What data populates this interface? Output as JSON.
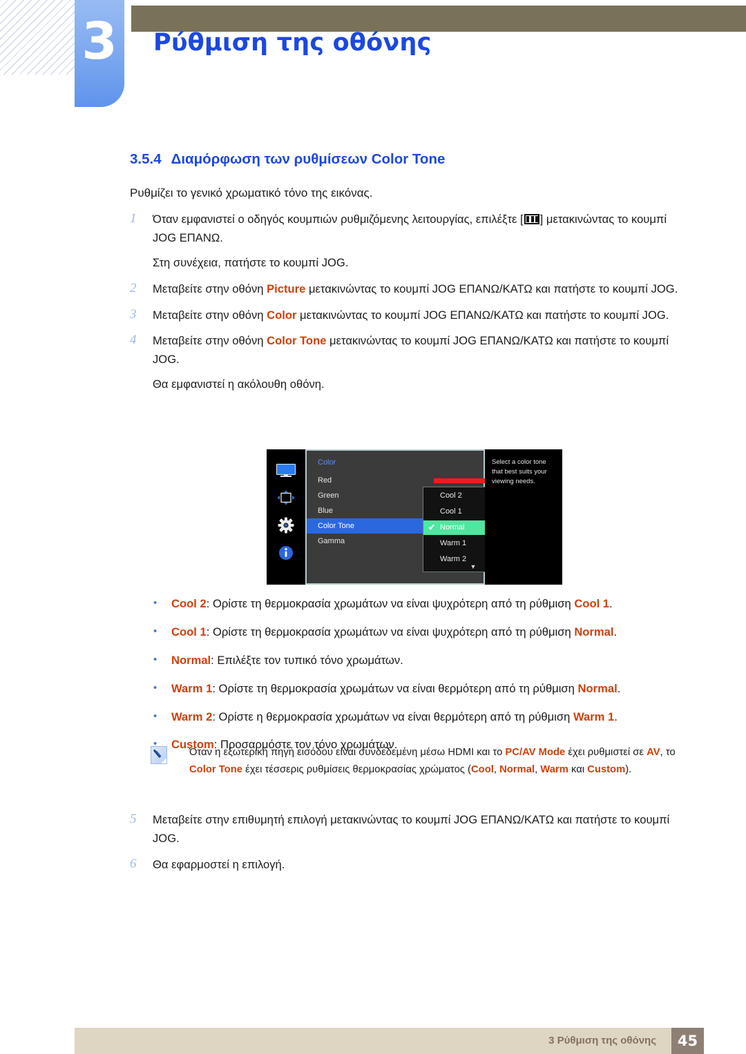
{
  "header": {
    "chapter_number": "3",
    "chapter_title": "Ρύθμιση της οθόνης"
  },
  "section": {
    "number": "3.5.4",
    "title": "Διαμόρφωση των ρυθμίσεων Color Tone",
    "intro": "Ρυθμίζει το γενικό χρωματικό τόνο της εικόνας."
  },
  "steps": {
    "s1_num": "1",
    "s1_a": "Όταν εμφανιστεί ο οδηγός κουμπιών ρυθμιζόμενης λειτουργίας, επιλέξτε [",
    "s1_b": "] μετακινώντας το κουμπί JOG ΕΠΑΝΩ.",
    "s1_sub": "Στη συνέχεια, πατήστε το κουμπί JOG.",
    "s2_num": "2",
    "s2_a": "Μεταβείτε στην οθόνη ",
    "s2_bold": "Picture",
    "s2_b": " μετακινώντας το κουμπί JOG ΕΠΑΝΩ/ΚΑΤΩ και πατήστε το κουμπί JOG.",
    "s3_num": "3",
    "s3_a": "Μεταβείτε στην οθόνη ",
    "s3_bold": "Color",
    "s3_b": " μετακινώντας το κουμπί JOG ΕΠΑΝΩ/ΚΑΤΩ και πατήστε το κουμπί JOG.",
    "s4_num": "4",
    "s4_a": "Μεταβείτε στην οθόνη ",
    "s4_bold": "Color Tone",
    "s4_b": " μετακινώντας το κουμπί JOG ΕΠΑΝΩ/ΚΑΤΩ και πατήστε το κουμπί JOG.",
    "s4_sub": "Θα εμφανιστεί η ακόλουθη οθόνη.",
    "s5_num": "5",
    "s5_a": "Μεταβείτε στην επιθυμητή επιλογή μετακινώντας το κουμπί JOG ΕΠΑΝΩ/ΚΑΤΩ και πατήστε το κουμπί JOG.",
    "s6_num": "6",
    "s6_a": "Θα εφαρμοστεί η επιλογή."
  },
  "osd": {
    "menu_title": "Color",
    "rail_icons": [
      "monitor-icon",
      "move-arrows-icon",
      "gear-icon",
      "info-icon"
    ],
    "rows": [
      {
        "label": "Red",
        "selected": false
      },
      {
        "label": "Green",
        "selected": false
      },
      {
        "label": "Blue",
        "selected": false
      },
      {
        "label": "Color Tone",
        "selected": true
      },
      {
        "label": "Gamma",
        "selected": false
      }
    ],
    "slider": {
      "value": "50",
      "percent": 50
    },
    "dropdown": [
      {
        "label": "Cool 2",
        "checked": false
      },
      {
        "label": "Cool 1",
        "checked": false
      },
      {
        "label": "Normal",
        "checked": true
      },
      {
        "label": "Warm 1",
        "checked": false
      },
      {
        "label": "Warm 2",
        "checked": false
      }
    ],
    "dropdown_more": "▼",
    "check_glyph": "✔",
    "help_text": "Select a color tone that best suits your viewing needs."
  },
  "bullets": {
    "dot": "•",
    "b1_bold": "Cool 2",
    "b1_mid": ": Ορίστε τη θερμοκρασία χρωμάτων να είναι ψυχρότερη από τη ρύθμιση ",
    "b1_bold2": "Cool 1",
    "b1_end": ".",
    "b2_bold": "Cool 1",
    "b2_mid": ": Ορίστε τη θερμοκρασία χρωμάτων να είναι ψυχρότερη από τη ρύθμιση ",
    "b2_bold2": "Normal",
    "b2_end": ".",
    "b3_bold": "Normal",
    "b3_mid": ": Επιλέξτε τον τυπικό τόνο χρωμάτων.",
    "b4_bold": "Warm 1",
    "b4_mid": ": Ορίστε τη θερμοκρασία χρωμάτων να είναι θερμότερη από τη ρύθμιση ",
    "b4_bold2": "Normal",
    "b4_end": ".",
    "b5_bold": "Warm 2",
    "b5_mid": ": Ορίστε η θερμοκρασία χρωμάτων να είναι θερμότερη από τη ρύθμιση ",
    "b5_bold2": "Warm 1",
    "b5_end": ".",
    "b6_bold": "Custom",
    "b6_mid": ": Προσαρμόστε τον τόνο χρωμάτων."
  },
  "note": {
    "icon": "note-pencil-icon",
    "t1": "Όταν η εξωτερική πηγή εισόδου είναι συνδεδεμένη μέσω HDMI και το ",
    "b1": "PC/AV Mode",
    "t2": " έχει ρυθμιστεί σε ",
    "b2": "AV",
    "t3": ", το ",
    "b3": "Color Tone",
    "t4": " έχει τέσσερις ρυθμίσεις θερμοκρασίας χρώματος (",
    "b4": "Cool",
    "t5": ", ",
    "b5": "Normal",
    "t6": ", ",
    "b6": "Warm",
    "t7": " και ",
    "b7": "Custom",
    "t8": ")."
  },
  "footer": {
    "text": "3 Ρύθμιση της οθόνης",
    "page": "45"
  },
  "colors": {
    "accent_blue": "#1b48e0",
    "term_red": "#d1400a",
    "brown_bar": "#7a7258",
    "footer_bar": "#ded6c2",
    "footer_page": "#8e7f74",
    "osd_select": "#2a68e0",
    "osd_check": "#4fe6a0"
  }
}
